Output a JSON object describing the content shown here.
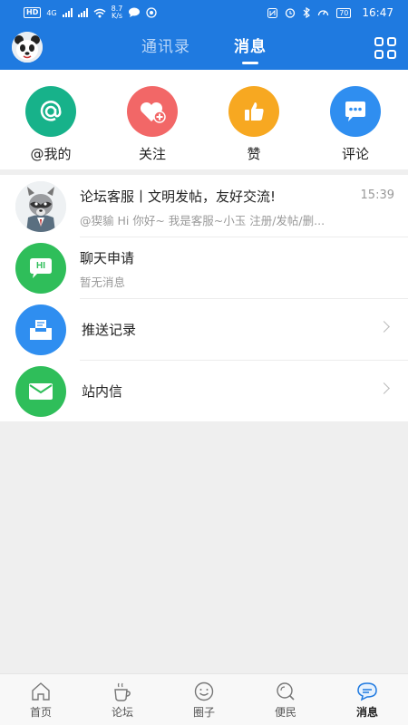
{
  "status_bar": {
    "left_badge": "HD",
    "network": "4G",
    "speed_value": "8.7",
    "speed_unit": "K/s",
    "battery": "70",
    "time": "16:47"
  },
  "header": {
    "tabs": [
      {
        "label": "通讯录",
        "active": false
      },
      {
        "label": "消息",
        "active": true
      }
    ],
    "accent_color": "#1f7ae0"
  },
  "quick_actions": [
    {
      "label": "@我的",
      "icon": "at-icon",
      "color": "#17b28a"
    },
    {
      "label": "关注",
      "icon": "heart-plus-icon",
      "color": "#f26767"
    },
    {
      "label": "赞",
      "icon": "thumbs-up-icon",
      "color": "#f7a821"
    },
    {
      "label": "评论",
      "icon": "comment-icon",
      "color": "#2f8ef0"
    }
  ],
  "messages": [
    {
      "title": "论坛客服丨文明发帖，友好交流!",
      "preview": "@猰貐 Hi 你好~ 我是客服~小玉 注册/发帖/删...",
      "time": "15:39"
    },
    {
      "title": "聊天申请",
      "preview": "暂无消息",
      "icon_text": "HI"
    }
  ],
  "links": [
    {
      "label": "推送记录",
      "icon": "inbox-icon",
      "color": "#2f8ef0"
    },
    {
      "label": "站内信",
      "icon": "mail-icon",
      "color": "#2fbe5a"
    }
  ],
  "bottom_nav": [
    {
      "label": "首页",
      "icon": "home-icon",
      "active": false
    },
    {
      "label": "论坛",
      "icon": "coffee-icon",
      "active": false
    },
    {
      "label": "圈子",
      "icon": "smile-circle-icon",
      "active": false
    },
    {
      "label": "便民",
      "icon": "search-icon",
      "active": false
    },
    {
      "label": "消息",
      "icon": "chat-bubble-icon",
      "active": true
    }
  ]
}
